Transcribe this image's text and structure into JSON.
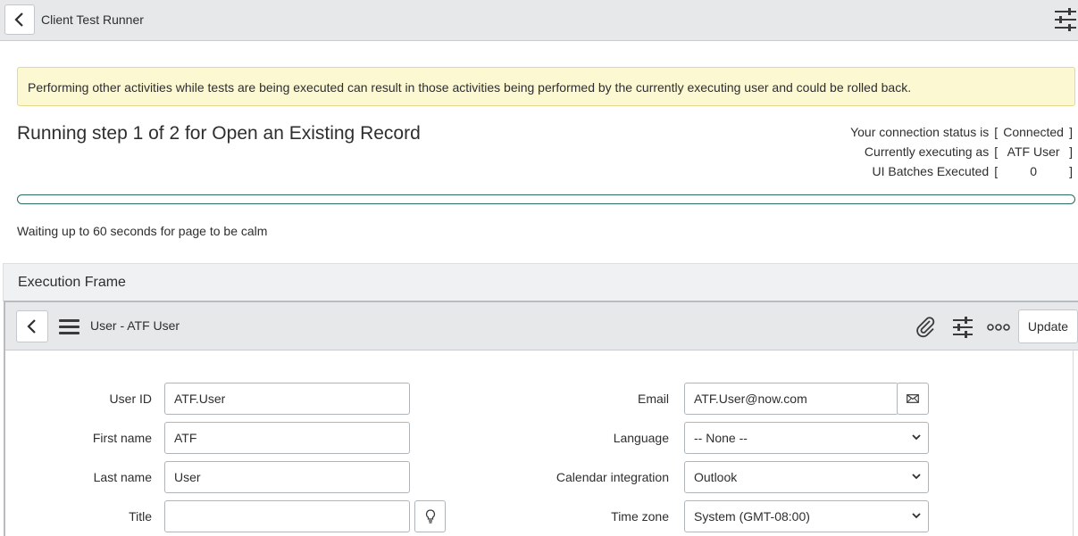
{
  "topbar": {
    "title": "Client Test Runner"
  },
  "warning": "Performing other activities while tests are being executed can result in those activities being performed by the currently executing user and could be rolled back.",
  "run_title": "Running step 1 of 2 for Open an Existing Record",
  "status": {
    "connection_label": "Your connection status is",
    "connection_value": "Connected",
    "executing_label": "Currently executing as",
    "executing_value": "ATF User",
    "batches_label": "UI Batches Executed",
    "batches_value": "0",
    "open_bracket": "[",
    "close_bracket": "]"
  },
  "progress": {
    "fraction": 0.0,
    "color": "#2b6b63"
  },
  "wait_message": "Waiting up to 60 seconds for page to be calm",
  "execution_frame": {
    "label": "Execution Frame",
    "form_title": "User - ATF User",
    "update_label": "Update",
    "fields": {
      "user_id": {
        "label": "User ID",
        "value": "ATF.User"
      },
      "first_name": {
        "label": "First name",
        "value": "ATF"
      },
      "last_name": {
        "label": "Last name",
        "value": "User"
      },
      "title": {
        "label": "Title",
        "value": ""
      },
      "email": {
        "label": "Email",
        "value": "ATF.User@now.com"
      },
      "language": {
        "label": "Language",
        "value": "-- None --"
      },
      "calendar": {
        "label": "Calendar integration",
        "value": "Outlook"
      },
      "timezone": {
        "label": "Time zone",
        "value": "System (GMT-08:00)"
      }
    }
  },
  "colors": {
    "warning_bg": "#fcf8d2",
    "header_bg": "#e6e8ea",
    "accent": "#2b6b63"
  },
  "icons": [
    "chevron-left-icon",
    "sliders-icon",
    "hamburger-menu-icon",
    "paperclip-icon",
    "more-options-icon",
    "envelope-icon",
    "lightbulb-icon",
    "chevron-down-icon"
  ]
}
